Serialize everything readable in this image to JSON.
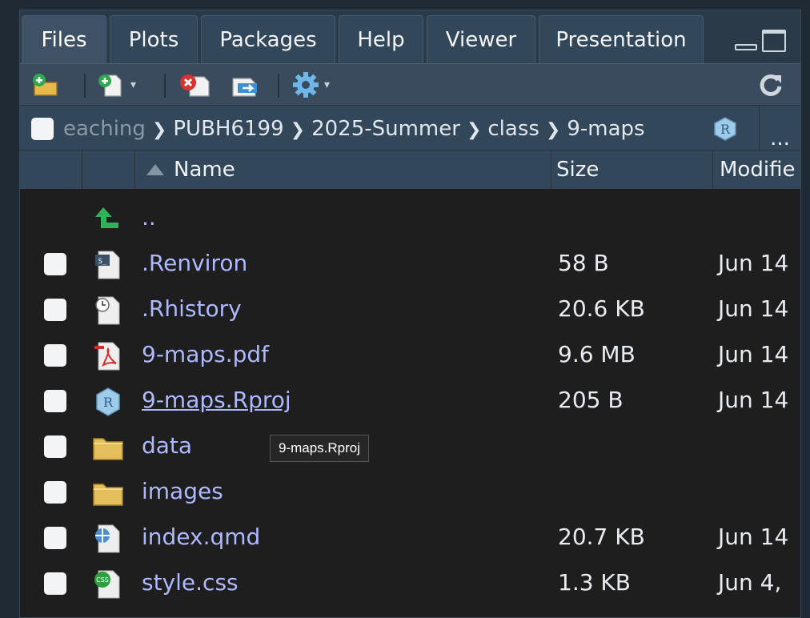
{
  "tabs": [
    {
      "label": "Files",
      "active": true
    },
    {
      "label": "Plots",
      "active": false
    },
    {
      "label": "Packages",
      "active": false
    },
    {
      "label": "Help",
      "active": false
    },
    {
      "label": "Viewer",
      "active": false
    },
    {
      "label": "Presentation",
      "active": false
    }
  ],
  "toolbar": {
    "icons": [
      "new-folder-icon",
      "new-file-icon",
      "delete-icon",
      "rename-icon",
      "gear-icon",
      "refresh-icon"
    ]
  },
  "breadcrumb": {
    "first_partial": "eaching",
    "items": [
      "PUBH6199",
      "2025-Summer",
      "class",
      "9-maps"
    ],
    "more_label": "..."
  },
  "columns": {
    "name": "Name",
    "size": "Size",
    "modified": "Modifie"
  },
  "parent_row": {
    "label": ".."
  },
  "files": [
    {
      "name": ".Renviron",
      "size": "58 B",
      "modified": "Jun 14",
      "icon": "shell-file-icon"
    },
    {
      "name": ".Rhistory",
      "size": "20.6 KB",
      "modified": "Jun 14",
      "icon": "history-file-icon"
    },
    {
      "name": "9-maps.pdf",
      "size": "9.6 MB",
      "modified": "Jun 14",
      "icon": "pdf-file-icon"
    },
    {
      "name": "9-maps.Rproj",
      "size": "205 B",
      "modified": "Jun 14",
      "icon": "rproj-file-icon"
    },
    {
      "name": "data",
      "size": "",
      "modified": "",
      "icon": "folder-icon"
    },
    {
      "name": "images",
      "size": "",
      "modified": "",
      "icon": "folder-icon"
    },
    {
      "name": "index.qmd",
      "size": "20.7 KB",
      "modified": "Jun 14",
      "icon": "quarto-file-icon"
    },
    {
      "name": "style.css",
      "size": "1.3 KB",
      "modified": "Jun 4,",
      "icon": "css-file-icon"
    }
  ],
  "tooltip": {
    "text": "9-maps.Rproj"
  },
  "colors": {
    "accent_link": "#aeb8ff",
    "pane_bg": "#1e1e1e",
    "header_bg": "#33475a"
  }
}
